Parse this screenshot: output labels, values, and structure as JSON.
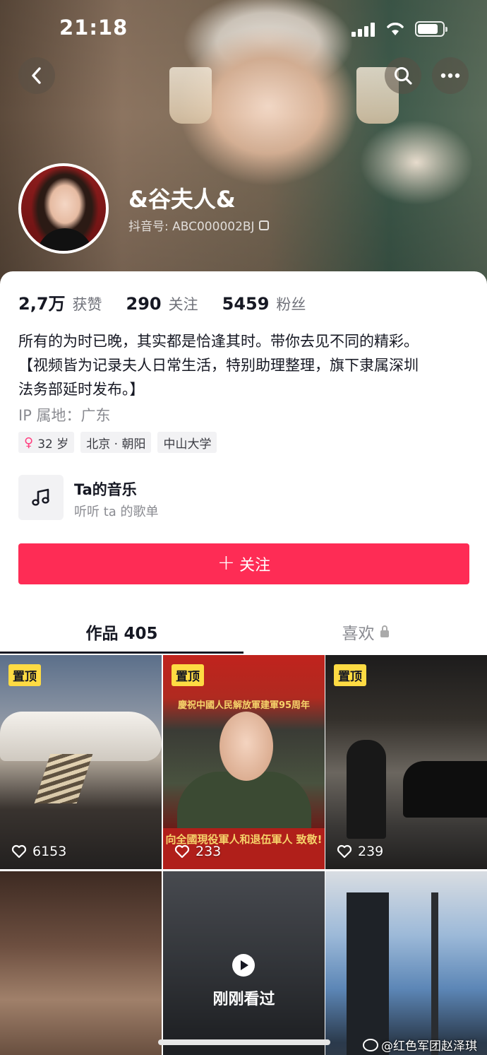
{
  "status_bar": {
    "time": "21:18"
  },
  "profile": {
    "nickname": "&谷夫人&",
    "douyin_id": "抖音号: ABC000002BJ"
  },
  "stats": [
    {
      "value": "2,7万",
      "label": "获赞"
    },
    {
      "value": "290",
      "label": "关注"
    },
    {
      "value": "5459",
      "label": "粉丝"
    }
  ],
  "bio": {
    "line1": "所有的为时已晚，其实都是恰逢其时。带你去见不同的精彩。",
    "line2": "【视频皆为记录夫人日常生活，特别助理整理，旗下隶属深圳",
    "line3": "法务部延时发布。】"
  },
  "ip_location": "IP 属地：广东",
  "tags": [
    {
      "label": "32 岁",
      "icon": "female-icon"
    },
    {
      "label": "北京 · 朝阳"
    },
    {
      "label": "中山大学"
    }
  ],
  "music": {
    "title": "Ta的音乐",
    "subtitle": "听听 ta 的歌单"
  },
  "follow_button": {
    "label": "关注"
  },
  "tabs": {
    "works": "作品 405",
    "likes": "喜欢"
  },
  "videos": [
    {
      "pinned": "置顶",
      "likes": "6153"
    },
    {
      "pinned": "置顶",
      "likes": "233",
      "banner_top": "慶祝中國人民解放軍建軍95周年",
      "banner_bottom": "向全國現役軍人和退伍軍人 致敬!"
    },
    {
      "pinned": "置顶",
      "likes": "239"
    },
    {},
    {
      "overlay": "刚刚看过"
    },
    {}
  ],
  "watermark": "@红色军团赵泽琪",
  "colors": {
    "follow_button": "#fe2c55",
    "pin_badge": "#fedb43",
    "female_icon": "#ff3f7f"
  }
}
